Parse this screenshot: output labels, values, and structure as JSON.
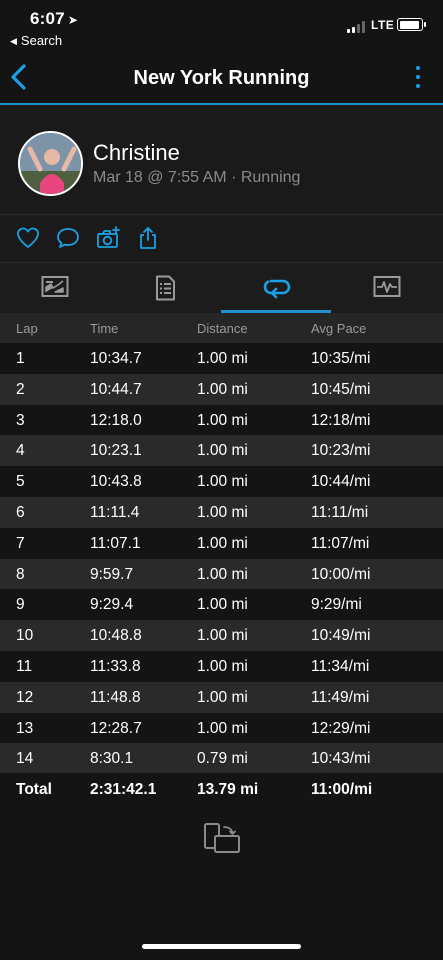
{
  "status": {
    "time": "6:07",
    "back_label": "Search",
    "carrier": "LTE",
    "battery_level": 0.95
  },
  "nav": {
    "title": "New York Running"
  },
  "profile": {
    "name": "Christine",
    "meta": "Mar 18 @ 7:55 AM · Running"
  },
  "actions": [
    {
      "icon": "heart-icon"
    },
    {
      "icon": "comment-icon"
    },
    {
      "icon": "camera-add-icon"
    },
    {
      "icon": "share-icon"
    }
  ],
  "tabs": [
    {
      "icon": "map-icon",
      "active": false
    },
    {
      "icon": "details-icon",
      "active": false
    },
    {
      "icon": "laps-icon",
      "active": true
    },
    {
      "icon": "chart-icon",
      "active": false
    }
  ],
  "laps_table": {
    "headers": {
      "lap": "Lap",
      "time": "Time",
      "distance": "Distance",
      "pace": "Avg Pace"
    },
    "rows": [
      {
        "lap": "1",
        "time": "10:34.7",
        "distance": "1.00 mi",
        "pace": "10:35/mi"
      },
      {
        "lap": "2",
        "time": "10:44.7",
        "distance": "1.00 mi",
        "pace": "10:45/mi"
      },
      {
        "lap": "3",
        "time": "12:18.0",
        "distance": "1.00 mi",
        "pace": "12:18/mi"
      },
      {
        "lap": "4",
        "time": "10:23.1",
        "distance": "1.00 mi",
        "pace": "10:23/mi"
      },
      {
        "lap": "5",
        "time": "10:43.8",
        "distance": "1.00 mi",
        "pace": "10:44/mi"
      },
      {
        "lap": "6",
        "time": "11:11.4",
        "distance": "1.00 mi",
        "pace": "11:11/mi"
      },
      {
        "lap": "7",
        "time": "11:07.1",
        "distance": "1.00 mi",
        "pace": "11:07/mi"
      },
      {
        "lap": "8",
        "time": "9:59.7",
        "distance": "1.00 mi",
        "pace": "10:00/mi"
      },
      {
        "lap": "9",
        "time": "9:29.4",
        "distance": "1.00 mi",
        "pace": "9:29/mi"
      },
      {
        "lap": "10",
        "time": "10:48.8",
        "distance": "1.00 mi",
        "pace": "10:49/mi"
      },
      {
        "lap": "11",
        "time": "11:33.8",
        "distance": "1.00 mi",
        "pace": "11:34/mi"
      },
      {
        "lap": "12",
        "time": "11:48.8",
        "distance": "1.00 mi",
        "pace": "11:49/mi"
      },
      {
        "lap": "13",
        "time": "12:28.7",
        "distance": "1.00 mi",
        "pace": "12:29/mi"
      },
      {
        "lap": "14",
        "time": "8:30.1",
        "distance": "0.79 mi",
        "pace": "10:43/mi"
      }
    ],
    "total": {
      "label": "Total",
      "time": "2:31:42.1",
      "distance": "13.79 mi",
      "pace": "11:00/mi"
    }
  },
  "colors": {
    "accent": "#1aa0e6",
    "background": "#141414",
    "row_alt": "#2a2a2a",
    "muted_text": "#8a8a8a"
  }
}
